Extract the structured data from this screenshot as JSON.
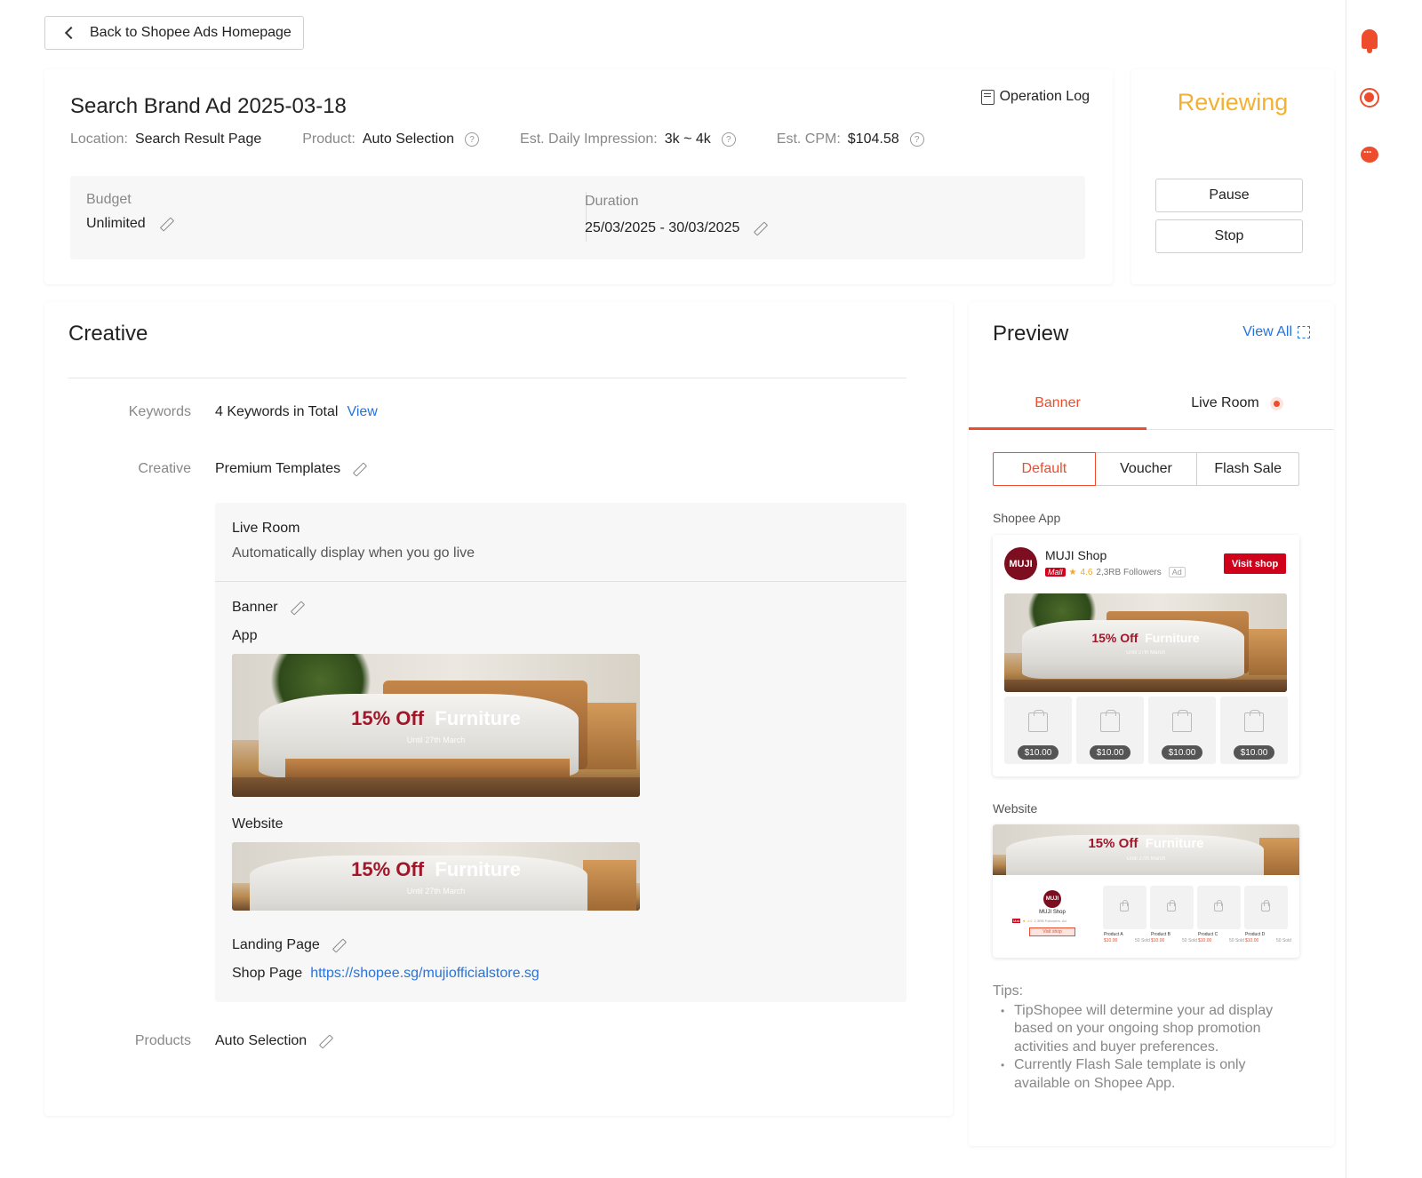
{
  "back_button": {
    "label": "Back to Shopee Ads Homepage"
  },
  "summary": {
    "title": "Search Brand Ad 2025-03-18",
    "operation_log": "Operation Log",
    "location_label": "Location:",
    "location_value": "Search Result Page",
    "product_label": "Product:",
    "product_value": "Auto Selection",
    "impression_label": "Est. Daily Impression:",
    "impression_value": "3k ~ 4k",
    "cpm_label": "Est. CPM:",
    "cpm_value": "$104.58",
    "budget_label": "Budget",
    "budget_value": "Unlimited",
    "duration_label": "Duration",
    "duration_value": "25/03/2025 - 30/03/2025"
  },
  "status": {
    "text": "Reviewing",
    "color": "#f2b135",
    "pause_label": "Pause",
    "stop_label": "Stop"
  },
  "creative": {
    "title": "Creative",
    "keywords_label": "Keywords",
    "keywords_value": "4 Keywords in Total",
    "keywords_link": "View",
    "creative_label": "Creative",
    "creative_value": "Premium Templates",
    "live_room_title": "Live Room",
    "live_room_desc": "Automatically display when you go live",
    "banner_title": "Banner",
    "app_label": "App",
    "website_label": "Website",
    "landing_title": "Landing Page",
    "landing_type": "Shop Page",
    "landing_url": "https://shopee.sg/mujiofficialstore.sg",
    "products_label": "Products",
    "products_value": "Auto Selection"
  },
  "banner_art": {
    "promo_red": "15% Off",
    "promo_white": "Furniture",
    "until": "Until 27th March"
  },
  "preview": {
    "title": "Preview",
    "view_all": "View All",
    "tabs": [
      "Banner",
      "Live Room"
    ],
    "active_tab": "Banner",
    "templates": [
      "Default",
      "Voucher",
      "Flash Sale"
    ],
    "active_template": "Default",
    "shopee_app_label": "Shopee App",
    "website_label": "Website",
    "shop_name": "MUJI Shop",
    "logo_text": "MUJI",
    "mall_badge": "Mall",
    "rating": "4.6",
    "followers": "2,3RB Followers",
    "ad_tag": "Ad",
    "visit_shop": "Visit shop",
    "product_price": "$10.00",
    "web_products": [
      "Product A",
      "Product B",
      "Product C",
      "Product D"
    ],
    "web_price": "$10.00",
    "web_sold": "50 Sold",
    "web_followers": "2,3RB Followers",
    "tips_title": "Tips:",
    "tips": [
      "TipShopee will determine your ad display based on your ongoing shop promotion activities and buyer preferences.",
      "Currently Flash Sale template is only available on Shopee App."
    ]
  },
  "accent_color": "#ee4d2d",
  "link_color": "#2673dd"
}
